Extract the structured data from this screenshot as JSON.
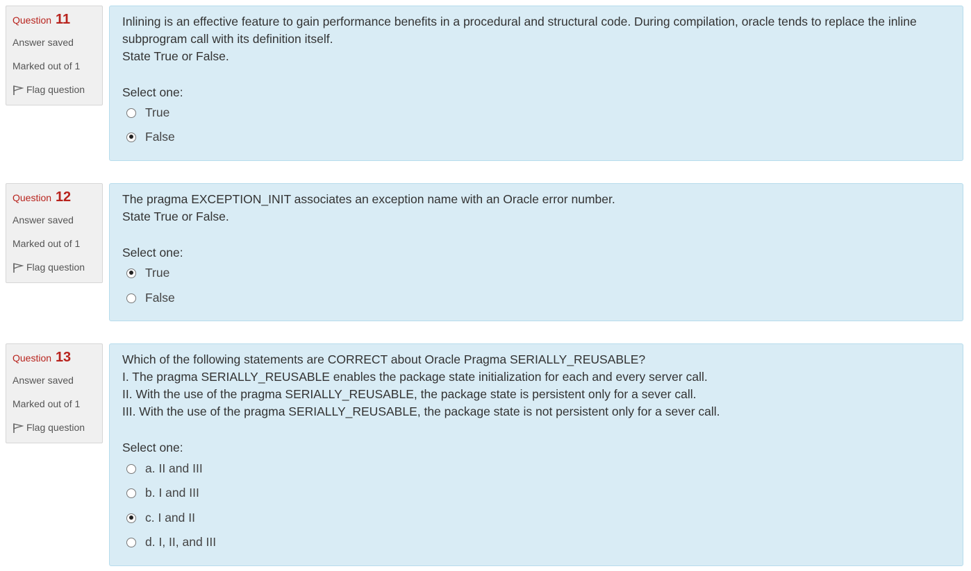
{
  "questions": [
    {
      "label": "Question",
      "number": "11",
      "state": "Answer saved",
      "grade": "Marked out of 1",
      "flag": "Flag question",
      "text": [
        "Inlining is an effective feature to gain performance benefits in a procedural and structural code. During compilation, oracle tends to replace the inline",
        "subprogram call with its definition itself.",
        "State True or False."
      ],
      "prompt": "Select one:",
      "options": [
        {
          "label": "True",
          "checked": false
        },
        {
          "label": "False",
          "checked": true
        }
      ]
    },
    {
      "label": "Question",
      "number": "12",
      "state": "Answer saved",
      "grade": "Marked out of 1",
      "flag": "Flag question",
      "text": [
        "The pragma EXCEPTION_INIT associates an exception name with an Oracle error number.",
        "State True or False."
      ],
      "prompt": "Select one:",
      "options": [
        {
          "label": "True",
          "checked": true
        },
        {
          "label": "False",
          "checked": false
        }
      ]
    },
    {
      "label": "Question",
      "number": "13",
      "state": "Answer saved",
      "grade": "Marked out of 1",
      "flag": "Flag question",
      "text": [
        "Which of the following statements are CORRECT about Oracle Pragma SERIALLY_REUSABLE?",
        "I. The pragma SERIALLY_REUSABLE enables the package state initialization for each and every server call.",
        "II. With the use of the pragma SERIALLY_REUSABLE, the package state is persistent only for a sever call.",
        "III. With the use of the pragma SERIALLY_REUSABLE, the package state is not persistent only for a sever call."
      ],
      "prompt": "Select one:",
      "options": [
        {
          "label": "a. II and III",
          "checked": false
        },
        {
          "label": "b. I and III",
          "checked": false
        },
        {
          "label": "c. I and II",
          "checked": true
        },
        {
          "label": "d. I, II, and III",
          "checked": false
        }
      ]
    }
  ]
}
